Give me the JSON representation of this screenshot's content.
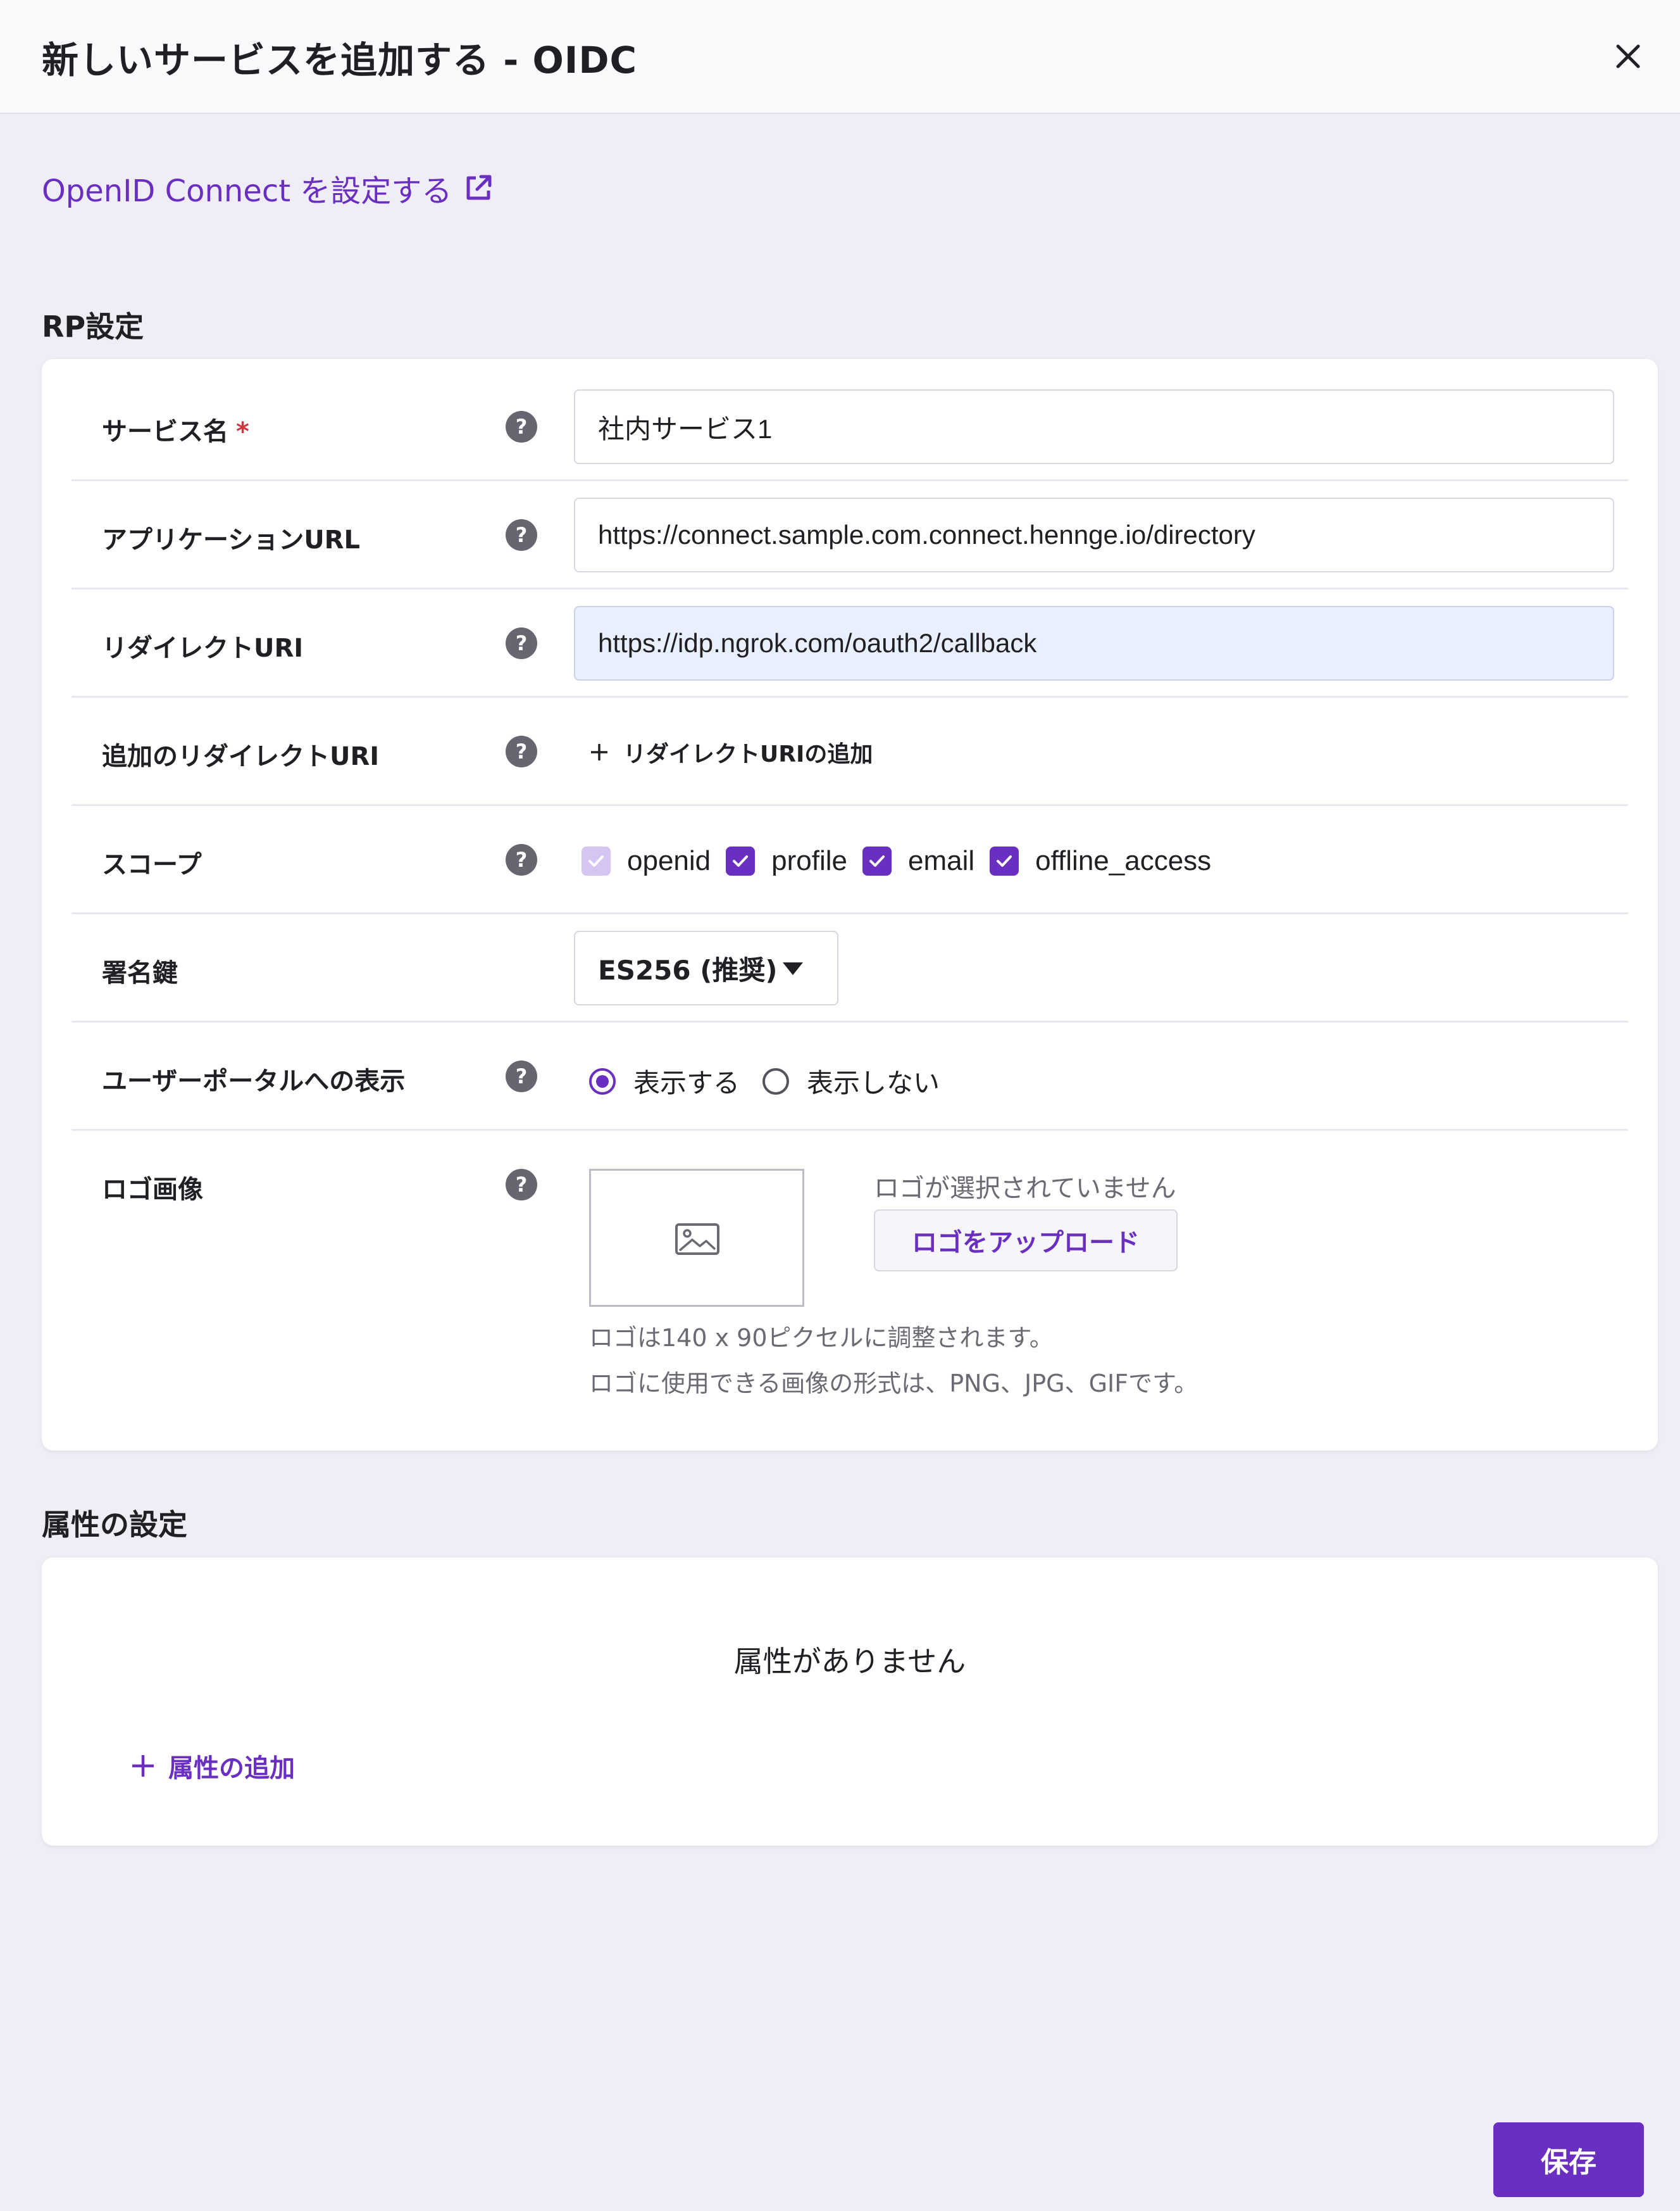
{
  "dialog": {
    "title": "新しいサービスを追加する - OIDC"
  },
  "external_link": {
    "label": "OpenID Connect を設定する"
  },
  "rp_section": {
    "heading": "RP設定",
    "service_name": {
      "label": "サービス名",
      "required_mark": "*",
      "value": "社内サービス1"
    },
    "application_url": {
      "label": "アプリケーションURL",
      "value": "https://connect.sample.com.connect.hennge.io/directory"
    },
    "redirect_uri": {
      "label": "リダイレクトURI",
      "value": "https://idp.ngrok.com/oauth2/callback"
    },
    "additional_redirect": {
      "label": "追加のリダイレクトURI",
      "add_label": "リダイレクトURIの追加"
    },
    "scope": {
      "label": "スコープ",
      "options": [
        {
          "label": "openid",
          "checked": true,
          "disabled": true
        },
        {
          "label": "profile",
          "checked": true,
          "disabled": false
        },
        {
          "label": "email",
          "checked": true,
          "disabled": false
        },
        {
          "label": "offline_access",
          "checked": true,
          "disabled": false
        }
      ]
    },
    "signing_key": {
      "label": "署名鍵",
      "selected": "ES256 (推奨)"
    },
    "portal_display": {
      "label": "ユーザーポータルへの表示",
      "options": [
        {
          "label": "表示する",
          "selected": true
        },
        {
          "label": "表示しない",
          "selected": false
        }
      ]
    },
    "logo": {
      "label": "ロゴ画像",
      "status": "ロゴが選択されていません",
      "upload_label": "ロゴをアップロード",
      "note_size": "ロゴは140 x 90ピクセルに調整されます。",
      "note_formats": "ロゴに使用できる画像の形式は、PNG、JPG、GIFです。"
    }
  },
  "attributes_section": {
    "heading": "属性の設定",
    "empty_text": "属性がありません",
    "add_label": "属性の追加"
  },
  "footer": {
    "save_label": "保存"
  },
  "colors": {
    "accent": "#6a2ec0",
    "required": "#d1343f",
    "background": "#efedf6"
  }
}
